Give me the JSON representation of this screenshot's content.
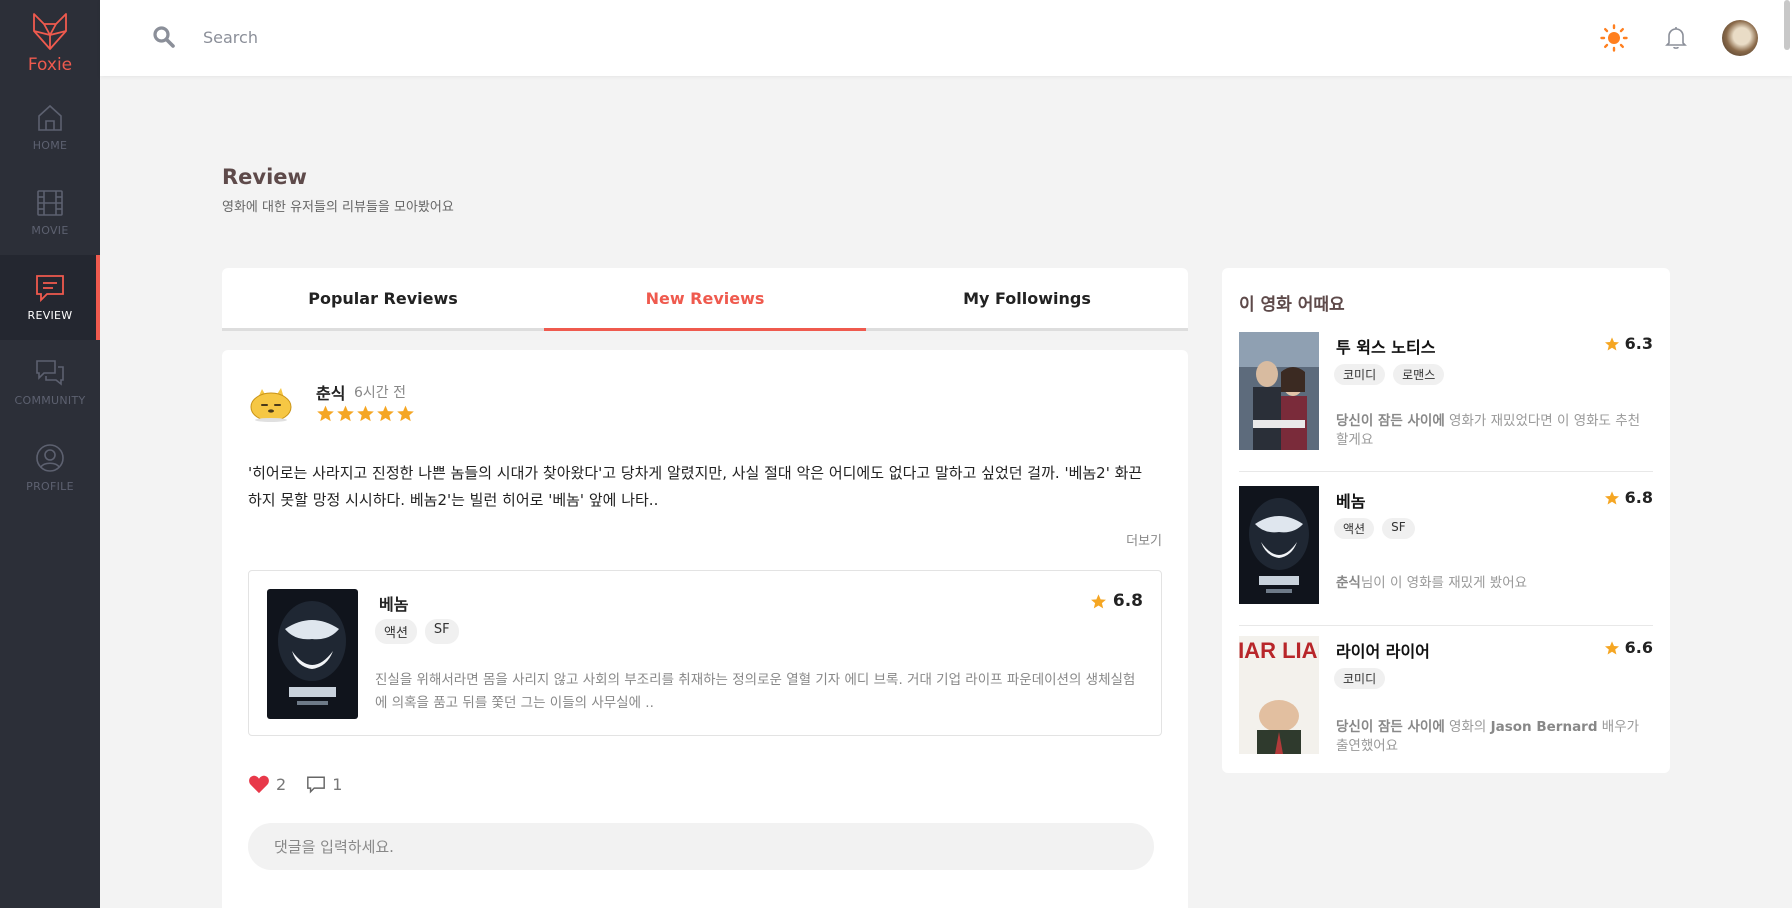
{
  "brand": {
    "name": "Foxie",
    "accent": "#ef5a4e"
  },
  "sidebar": {
    "items": [
      {
        "label": "HOME",
        "icon": "home-icon"
      },
      {
        "label": "MOVIE",
        "icon": "film-icon"
      },
      {
        "label": "REVIEW",
        "icon": "message-icon",
        "active": true
      },
      {
        "label": "COMMUNITY",
        "icon": "chat-icon"
      },
      {
        "label": "PROFILE",
        "icon": "user-icon"
      }
    ]
  },
  "topbar": {
    "search_placeholder": "Search"
  },
  "page": {
    "title": "Review",
    "subtitle": "영화에 대한 유저들의 리뷰들을 모아봤어요"
  },
  "tabs": [
    {
      "label": "Popular Reviews"
    },
    {
      "label": "New Reviews",
      "active": true
    },
    {
      "label": "My Followings"
    }
  ],
  "review": {
    "author": "춘식",
    "time": "6시간 전",
    "stars": 5,
    "text": "'히어로는 사라지고 진정한 나쁜 놈들의 시대가 찾아왔다'고 당차게 알렸지만, 사실 절대 악은 어디에도 없다고 말하고 싶었던 걸까. '베놈2' 화끈하지 못할 망정 시시하다. 베놈2'는 빌런 히어로 '베놈' 앞에 나타..",
    "more_label": "더보기",
    "movie": {
      "title": "베놈",
      "rating": "6.8",
      "tags": [
        "액션",
        "SF"
      ],
      "description": "진실을 위해서라면 몸을 사리지 않고 사회의 부조리를 취재하는 정의로운 열혈 기자 에디 브록. 거대 기업 라이프 파운데이션의 생체실험에 의혹을 품고 뒤를 쫓던 그는 이들의 사무실에 .."
    },
    "likes": "2",
    "comments": "1",
    "comment_placeholder": "댓글을 입력하세요."
  },
  "recommend": {
    "title": "이 영화 어때요",
    "items": [
      {
        "title": "투 윅스 노티스",
        "rating": "6.3",
        "tags": [
          "코미디",
          "로맨스"
        ],
        "note_bold": "당신이 잠든 사이에",
        "note": " 영화가 재밌었다면 이 영화도 추천할게요"
      },
      {
        "title": "베놈",
        "rating": "6.8",
        "tags": [
          "액션",
          "SF"
        ],
        "note_bold": "춘식",
        "note": "님이 이 영화를 재밌게 봤어요"
      },
      {
        "title": "라이어 라이어",
        "rating": "6.6",
        "tags": [
          "코미디"
        ],
        "note_bold": "당신이 잠든 사이에",
        "note_mid": " 영화의 ",
        "note_bold2": "Jason Bernard",
        "note": " 배우가 출연했어요",
        "poster_text": "LIAR LIAR"
      }
    ]
  }
}
